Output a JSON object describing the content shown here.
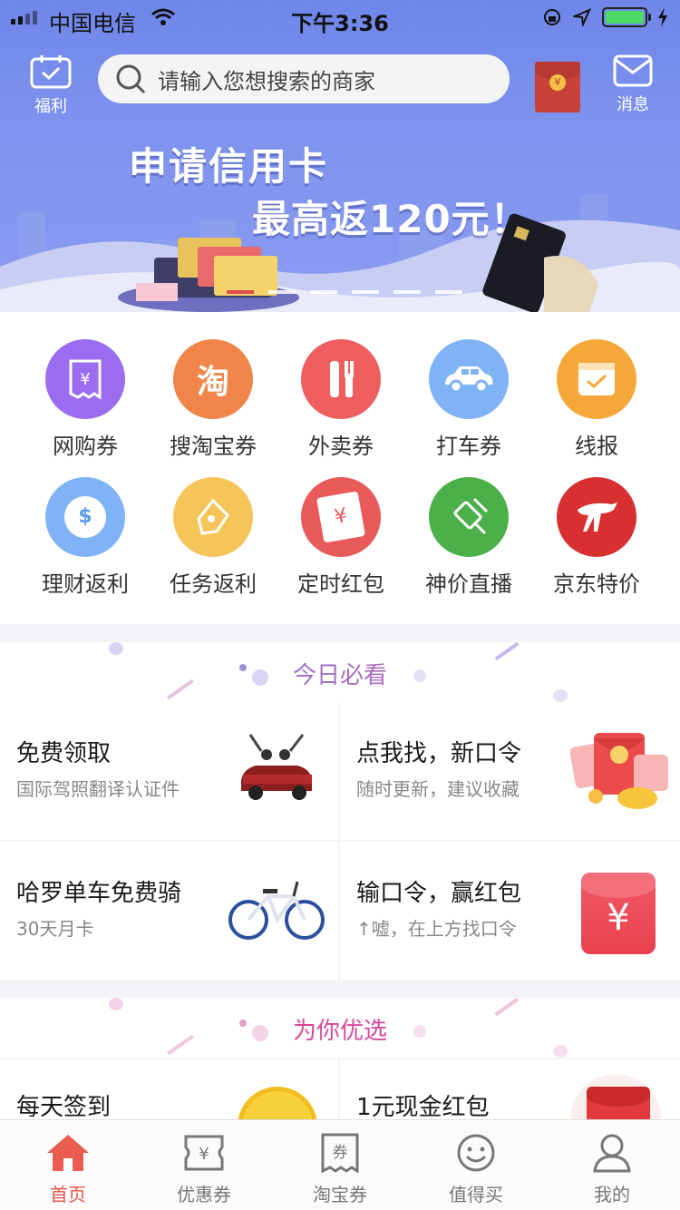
{
  "status_bar": {
    "carrier": "中国电信",
    "time": "下午3:36"
  },
  "header": {
    "welfare_label": "福利",
    "search_placeholder": "请输入您想搜索的商家",
    "message_label": "消息",
    "red_packet_symbol": "¥"
  },
  "banner": {
    "line1": "申请信用卡",
    "line2": "最高返120元！",
    "slides": 6,
    "active_slide": 1
  },
  "grid": [
    {
      "label": "网购券",
      "icon": "receipt-icon",
      "color": "#9a6cf0"
    },
    {
      "label": "搜淘宝券",
      "icon": "taobao-icon",
      "color": "#f0854a",
      "glyph": "淘"
    },
    {
      "label": "外卖券",
      "icon": "fork-knife-icon",
      "color": "#ee5e5e"
    },
    {
      "label": "打车券",
      "icon": "car-icon",
      "color": "#7fb3f5"
    },
    {
      "label": "线报",
      "icon": "calendar-check-icon",
      "color": "#f5a83a"
    },
    {
      "label": "理财返利",
      "icon": "dollar-icon",
      "color": "#7fb3f5",
      "glyph": "$"
    },
    {
      "label": "任务返利",
      "icon": "pen-icon",
      "color": "#f5c55a"
    },
    {
      "label": "定时红包",
      "icon": "red-envelope-icon",
      "color": "#e95a5a",
      "glyph": "¥"
    },
    {
      "label": "神价直播",
      "icon": "hammer-icon",
      "color": "#4bb04a"
    },
    {
      "label": "京东特价",
      "icon": "jd-dog-icon",
      "color": "#d83030"
    }
  ],
  "section_today": {
    "title": "今日必看",
    "cards": [
      {
        "title": "免费领取",
        "subtitle": "国际驾照翻译认证件",
        "image": "car-image"
      },
      {
        "title": "点我找，新口令",
        "subtitle": "随时更新，建议收藏",
        "image": "red-envelope-image"
      },
      {
        "title": "哈罗单车免费骑",
        "subtitle": "30天月卡",
        "image": "bicycle-image"
      },
      {
        "title": "输口令，赢红包",
        "subtitle": "↑嘘，在上方找口令",
        "image": "red-envelope-image",
        "glyph": "¥"
      }
    ]
  },
  "section_picks": {
    "title": "为你优选",
    "cards": [
      {
        "title": "每天签到",
        "image": "gold-coin-image"
      },
      {
        "title": "1元现金红包",
        "image": "red-envelope-image"
      }
    ]
  },
  "tabbar": {
    "tabs": [
      {
        "label": "首页",
        "icon": "home-icon",
        "active": true
      },
      {
        "label": "优惠券",
        "icon": "coupon-icon",
        "active": false,
        "glyph": "¥"
      },
      {
        "label": "淘宝券",
        "icon": "taobao-coupon-icon",
        "active": false,
        "glyph": "券"
      },
      {
        "label": "值得买",
        "icon": "smile-icon",
        "active": false
      },
      {
        "label": "我的",
        "icon": "user-icon",
        "active": false
      }
    ]
  },
  "colors": {
    "header": "#7e93ee",
    "accent": "#e8534a",
    "title_today_from": "#6a7ce8",
    "title_today_to": "#e05aa0"
  }
}
